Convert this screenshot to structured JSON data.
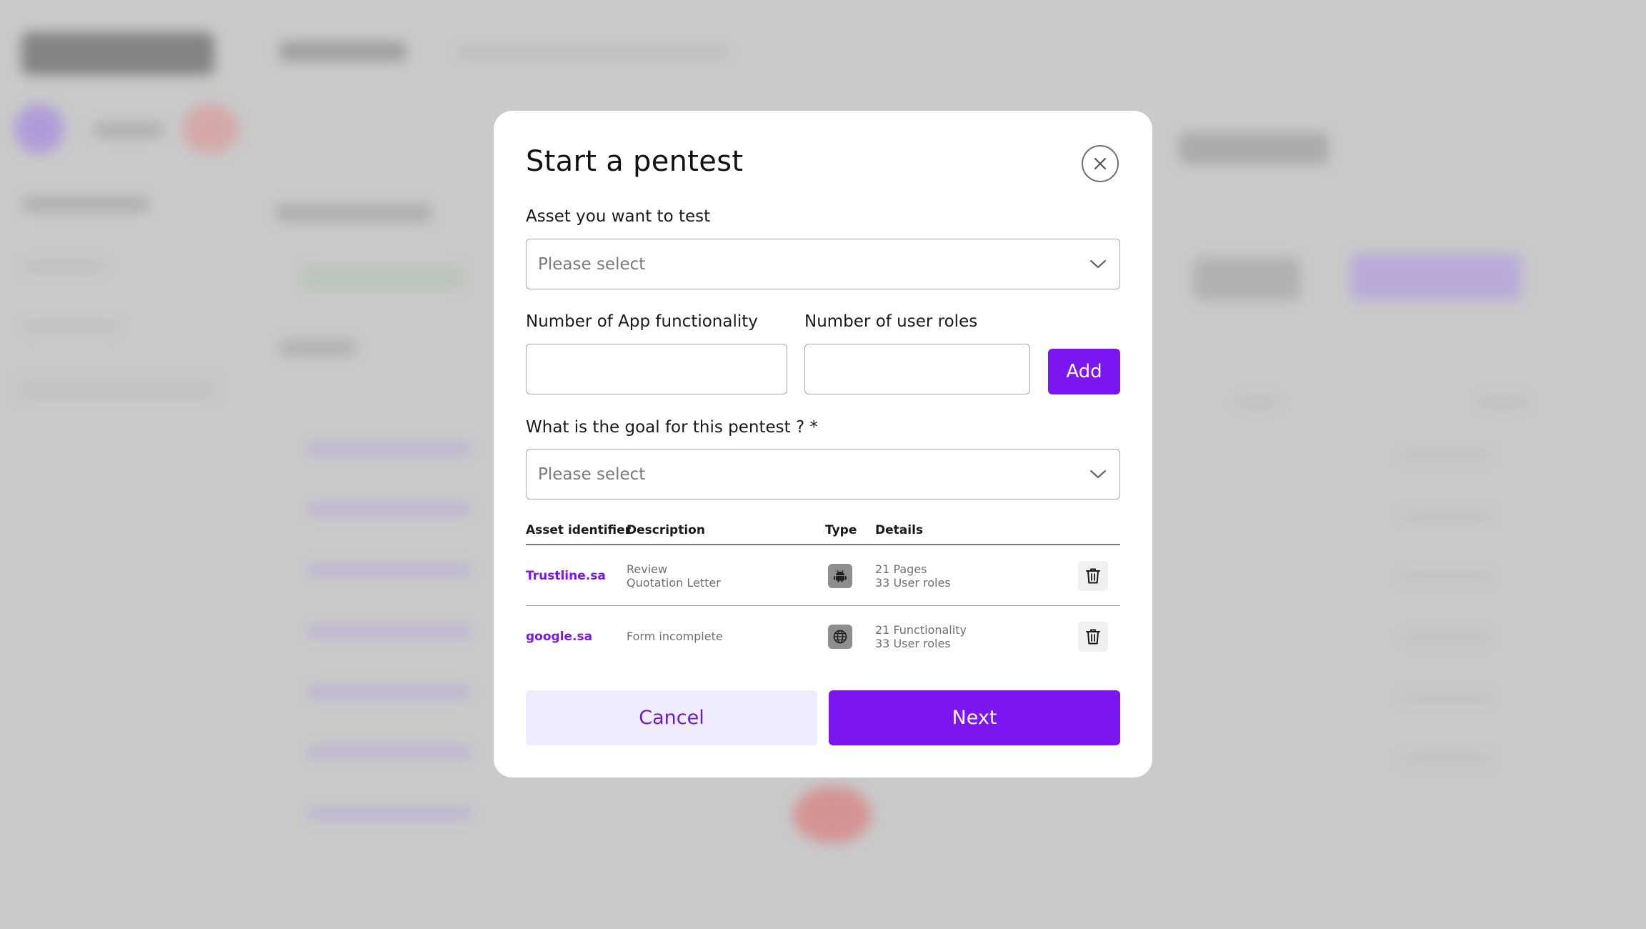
{
  "modal": {
    "title": "Start a pentest",
    "asset_label": "Asset you want to test",
    "asset_placeholder": "Please select",
    "app_functionality_label": "Number of App functionality",
    "user_roles_label": "Number of user roles",
    "add_label": "Add",
    "goal_label": "What is the goal for this pentest ? *",
    "goal_placeholder": "Please select",
    "table": {
      "headers": [
        "Asset identifier",
        "Description",
        "Type",
        "Details"
      ],
      "rows": [
        {
          "identifier": "Trustline.sa",
          "description_line1": "Review",
          "description_line2": "Quotation Letter",
          "type_icon": "android-icon",
          "details_line1": "21 Pages",
          "details_line2": "33 User roles"
        },
        {
          "identifier": "google.sa",
          "description_line1": "Form incomplete",
          "description_line2": "",
          "type_icon": "globe-icon",
          "details_line1": "21 Functionality",
          "details_line2": "33 User roles"
        }
      ]
    },
    "cancel_label": "Cancel",
    "next_label": "Next"
  },
  "colors": {
    "accent": "#7b16f0",
    "cancel_bg": "#efecfd",
    "backdrop": "#cfcfcf"
  }
}
